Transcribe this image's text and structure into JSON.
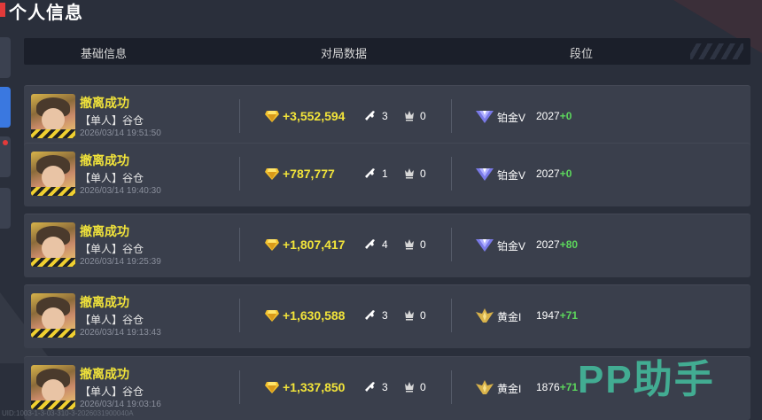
{
  "page": {
    "title": "个人信息"
  },
  "header": {
    "col_basic": "基础信息",
    "col_match": "对局数据",
    "col_rank": "段位"
  },
  "rows": [
    {
      "status": "撤离成功",
      "mode": "【单人】谷仓",
      "time": "2026/03/14 19:51:50",
      "money": "+3,552,594",
      "kills": "3",
      "assists": "0",
      "rank_name": "铂金V",
      "rank_score": "2027",
      "rank_delta": "+0",
      "rank_tier": "platinum"
    },
    {
      "status": "撤离成功",
      "mode": "【单人】谷仓",
      "time": "2026/03/14 19:40:30",
      "money": "+787,777",
      "kills": "1",
      "assists": "0",
      "rank_name": "铂金V",
      "rank_score": "2027",
      "rank_delta": "+0",
      "rank_tier": "platinum"
    },
    {
      "status": "撤离成功",
      "mode": "【单人】谷仓",
      "time": "2026/03/14 19:25:39",
      "money": "+1,807,417",
      "kills": "4",
      "assists": "0",
      "rank_name": "铂金V",
      "rank_score": "2027",
      "rank_delta": "+80",
      "rank_tier": "platinum"
    },
    {
      "status": "撤离成功",
      "mode": "【单人】谷仓",
      "time": "2026/03/14 19:13:43",
      "money": "+1,630,588",
      "kills": "3",
      "assists": "0",
      "rank_name": "黄金I",
      "rank_score": "1947",
      "rank_delta": "+71",
      "rank_tier": "gold"
    },
    {
      "status": "撤离成功",
      "mode": "【单人】谷仓",
      "time": "2026/03/14 19:03:16",
      "money": "+1,337,850",
      "kills": "3",
      "assists": "0",
      "rank_name": "黄金I",
      "rank_score": "1876",
      "rank_delta": "+71",
      "rank_tier": "gold"
    }
  ],
  "watermark": "PP助手",
  "uid_text": "UID:1003-1-3-03-310-3-2026031900040A",
  "colors": {
    "accent_yellow": "#f2e43a",
    "positive_green": "#5cd65c",
    "platinum": "#8c8cf0",
    "gold": "#d8b24a",
    "watermark": "#46d2aa"
  },
  "icons": {
    "currency": "gem-icon",
    "kills": "kill-icon",
    "assists": "assist-icon",
    "rank_platinum": "platinum-rank-icon",
    "rank_gold": "gold-rank-icon"
  }
}
